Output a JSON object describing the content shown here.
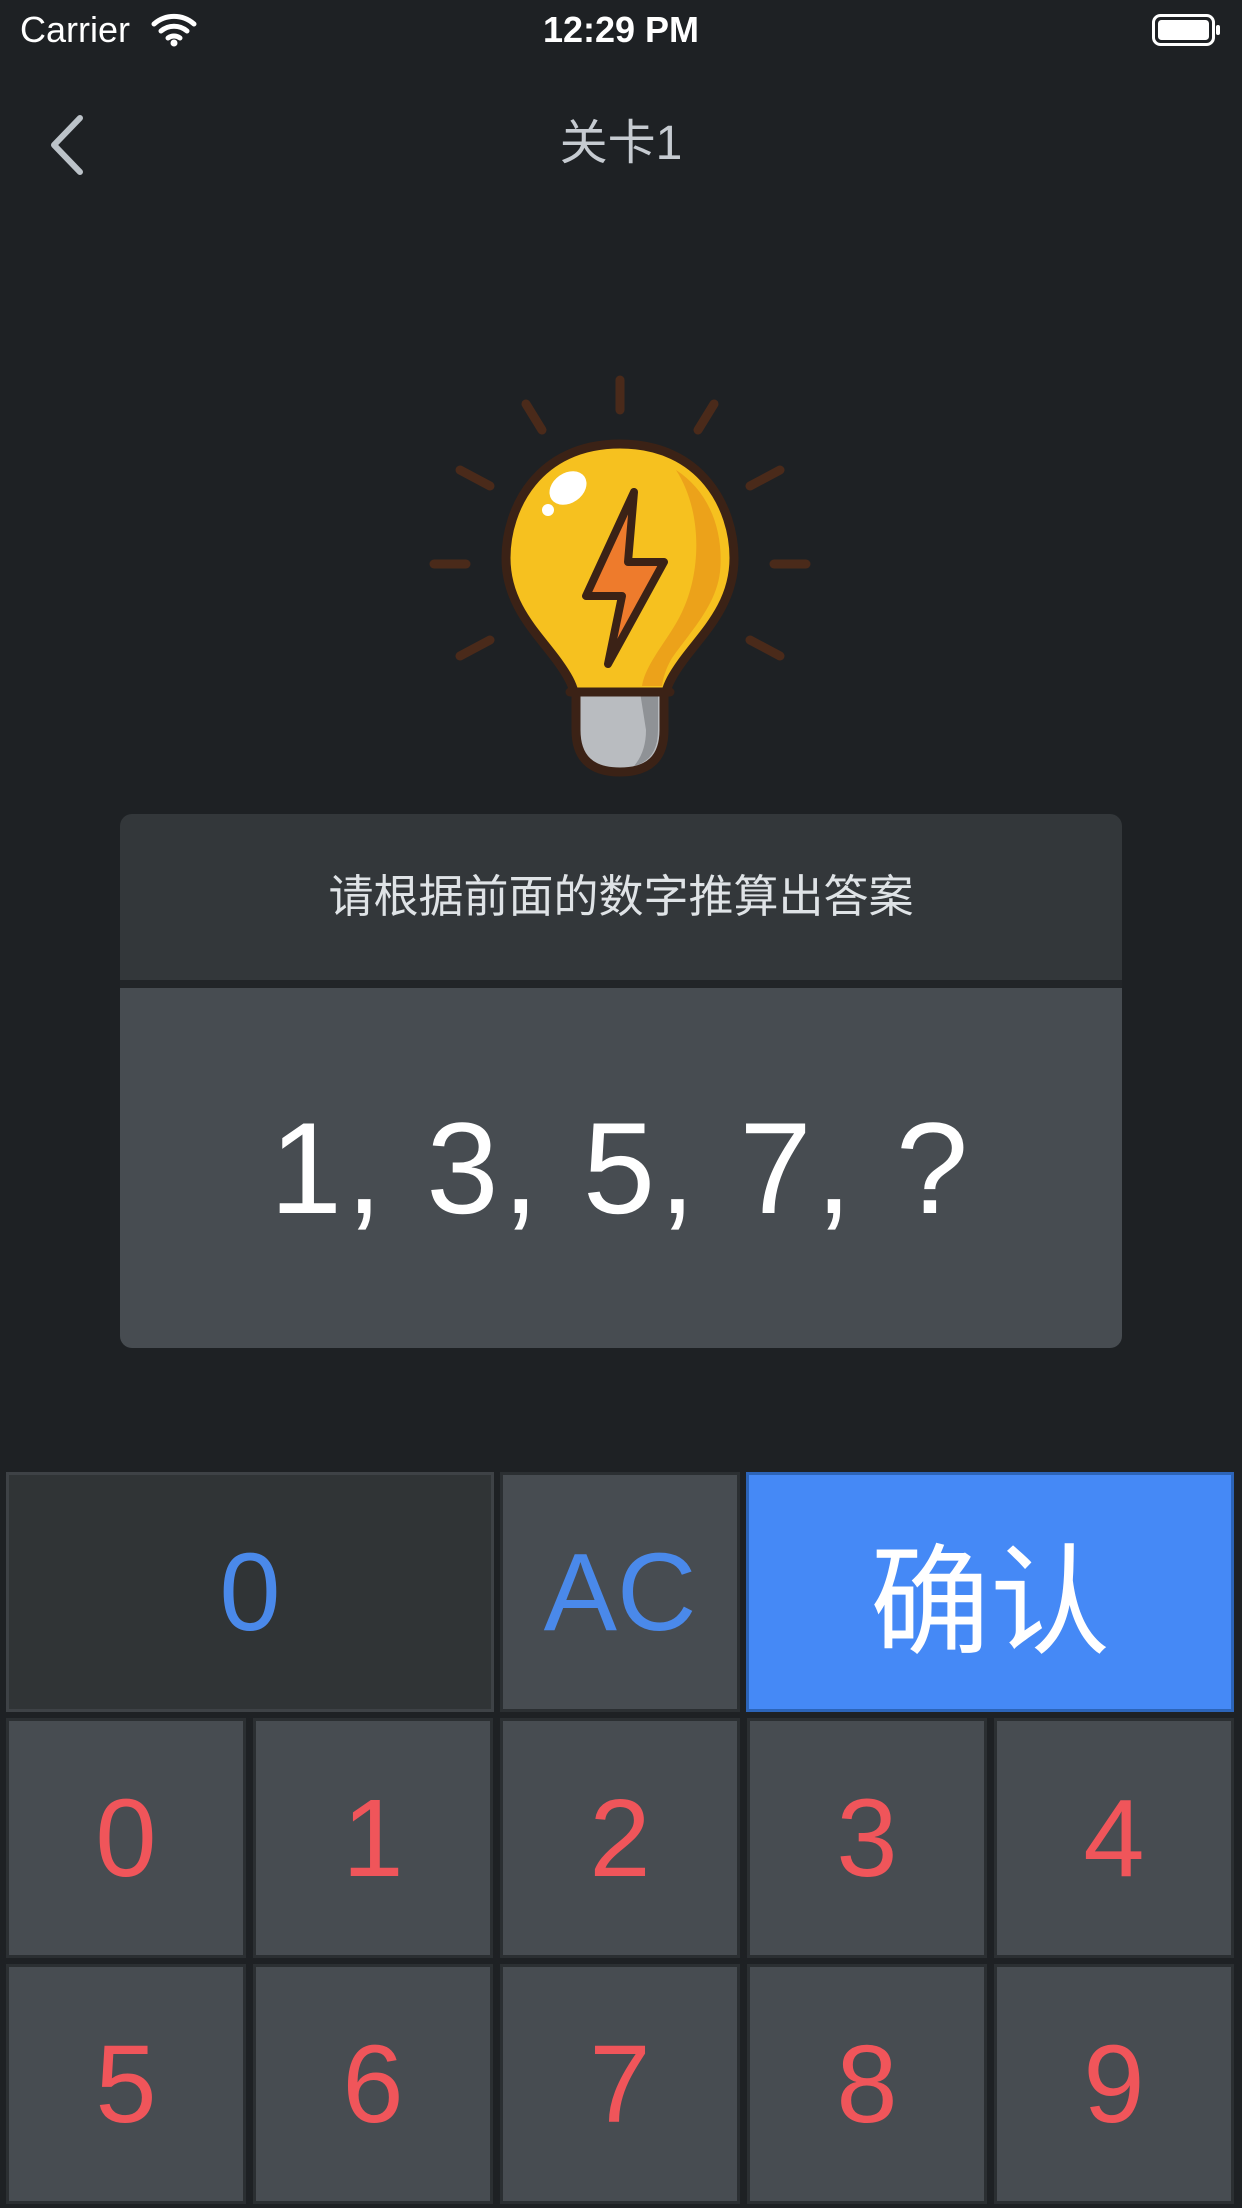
{
  "status_bar": {
    "carrier": "Carrier",
    "time": "12:29 PM"
  },
  "nav": {
    "title": "关卡1",
    "back_icon": "chevron-left-icon"
  },
  "hint_icon": "lightbulb-icon",
  "puzzle": {
    "instruction": "请根据前面的数字推算出答案",
    "sequence": "1, 3, 5, 7, ?"
  },
  "keypad": {
    "answer_value": "0",
    "clear_label": "AC",
    "confirm_label": "确认",
    "digits": [
      "0",
      "1",
      "2",
      "3",
      "4",
      "5",
      "6",
      "7",
      "8",
      "9"
    ]
  },
  "colors": {
    "background": "#1e2124",
    "accent_blue": "#4589f6",
    "digit_red": "#f0555a",
    "key_gray": "#474c51"
  }
}
